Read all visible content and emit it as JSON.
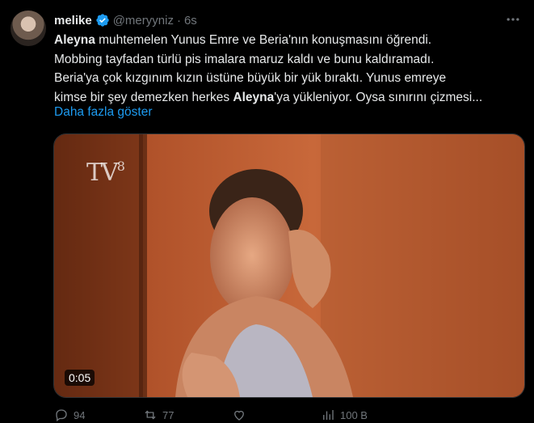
{
  "tweet": {
    "author_name": "melike",
    "handle": "@meryyniz",
    "separator": "·",
    "time": "6s",
    "text_parts": [
      {
        "t": "Aleyna",
        "b": true
      },
      {
        "t": " muhtemelen Yunus Emre ve Beria'nın konuşmasını öğrendi.\nMobbing tayfadan türlü pis imalara maruz kaldı ve bunu kaldıramadı.\nBeria'ya çok kızgınım kızın üstüne büyük bir yük bıraktı. Yunus emreye\nkimse bir şey demezken herkes ",
        "b": false
      },
      {
        "t": "Aleyna",
        "b": true
      },
      {
        "t": "'ya yükleniyor. Oysa sınırını çizmesi...",
        "b": false
      }
    ],
    "show_more": "Daha fazla göster",
    "video": {
      "duration": "0:05",
      "channel_logo_main": "TV",
      "channel_logo_num": "8"
    },
    "actions": {
      "reply": "94",
      "retweet": "77",
      "like": "",
      "views": "100 B"
    }
  },
  "colors": {
    "background": "#000000",
    "text": "#e7e9ea",
    "muted": "#71767b",
    "link": "#1d9bf0",
    "verified": "#1d9bf0"
  },
  "icons": [
    "verified-badge-icon",
    "more-options-icon",
    "reply-icon",
    "retweet-icon",
    "like-icon",
    "views-icon"
  ]
}
